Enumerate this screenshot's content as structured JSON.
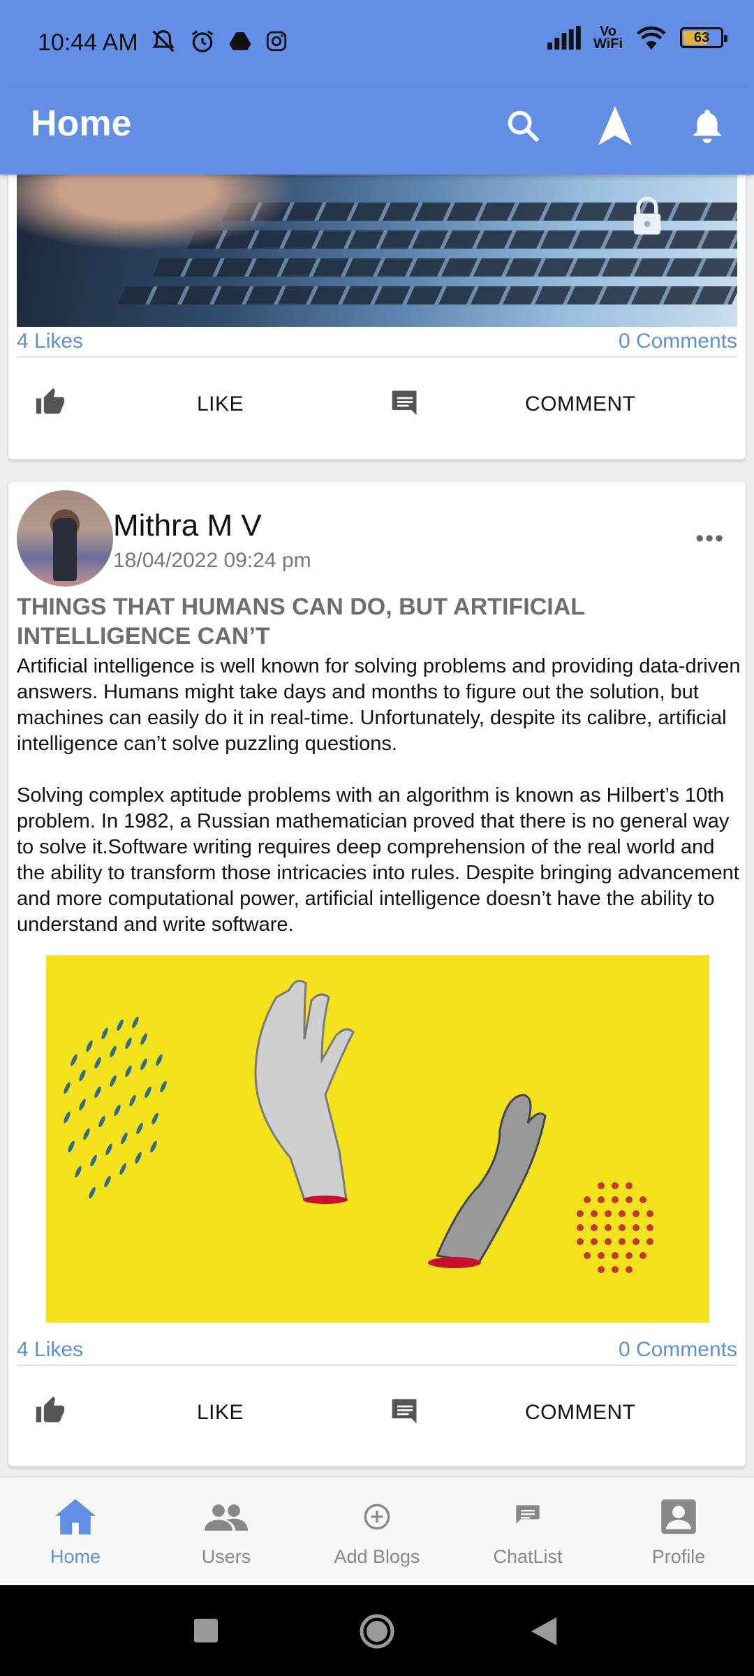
{
  "status_bar": {
    "time": "10:44 AM",
    "left_icons": [
      "mute-icon",
      "alarm-icon",
      "drive-icon",
      "instagram-icon"
    ],
    "right_icons": [
      "signal-icon",
      "vowifi-icon",
      "wifi-icon",
      "battery-icon"
    ],
    "vowifi_line1": "Vo",
    "vowifi_line2": "WiFi",
    "battery_level": "63"
  },
  "app_bar": {
    "title": "Home",
    "actions": [
      "search-icon",
      "navigation-icon",
      "bell-icon"
    ],
    "color": "#628fe5"
  },
  "posts": [
    {
      "likes": "4 Likes",
      "comments": "0 Comments",
      "like_label": "LIKE",
      "comment_label": "COMMENT"
    },
    {
      "author": "Mithra M V",
      "date": "18/04/2022 09:24 pm",
      "title": "THINGS THAT HUMANS CAN DO, BUT ARTIFICIAL INTELLIGENCE CAN’T",
      "body_paragraph_1": "Artificial intelligence is well known for solving problems and providing data-driven answers. Humans might take days and months to figure out the solution, but machines can easily do it in real-time. Unfortunately, despite its calibre, artificial intelligence can’t solve puzzling questions.",
      "body_paragraph_2": "Solving complex aptitude problems with an algorithm is known as Hilbert’s 10th problem. In 1982, a Russian mathematician proved that there is no general way to solve it.Software writing requires deep comprehension of the real world and the ability to transform those intricacies into rules. Despite bringing advancement and more computational power, artificial intelligence doesn’t have the ability to understand and write software.",
      "likes": "4 Likes",
      "comments": "0 Comments",
      "like_label": "LIKE",
      "comment_label": "COMMENT"
    }
  ],
  "bottom_nav": {
    "items": [
      {
        "label": "Home",
        "icon": "home-icon",
        "active": true
      },
      {
        "label": "Users",
        "icon": "users-icon",
        "active": false
      },
      {
        "label": "Add Blogs",
        "icon": "add-circle-icon",
        "active": false
      },
      {
        "label": "ChatList",
        "icon": "chat-icon",
        "active": false
      },
      {
        "label": "Profile",
        "icon": "profile-icon",
        "active": false
      }
    ]
  },
  "system_nav": [
    "recents-button",
    "home-button",
    "back-button"
  ]
}
